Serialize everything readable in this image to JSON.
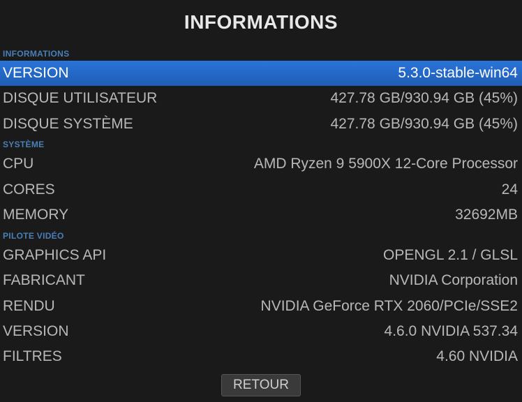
{
  "title": "INFORMATIONS",
  "sections": {
    "informations": {
      "header": "INFORMATIONS",
      "rows": [
        {
          "label": "VERSION",
          "value": "5.3.0-stable-win64",
          "selected": true
        },
        {
          "label": "DISQUE UTILISATEUR",
          "value": "427.78 GB/930.94 GB (45%)"
        },
        {
          "label": "DISQUE SYSTÈME",
          "value": "427.78 GB/930.94 GB (45%)"
        }
      ]
    },
    "systeme": {
      "header": "SYSTÈME",
      "rows": [
        {
          "label": "CPU",
          "value": "AMD Ryzen 9 5900X 12-Core Processor"
        },
        {
          "label": "CORES",
          "value": "24"
        },
        {
          "label": "MEMORY",
          "value": "32692MB"
        }
      ]
    },
    "pilote_video": {
      "header": "PILOTE VIDÉO",
      "rows": [
        {
          "label": "GRAPHICS API",
          "value": "OPENGL 2.1 / GLSL"
        },
        {
          "label": "FABRICANT",
          "value": "NVIDIA Corporation"
        },
        {
          "label": "RENDU",
          "value": "NVIDIA GeForce RTX 2060/PCIe/SSE2"
        },
        {
          "label": "VERSION",
          "value": "4.6.0 NVIDIA 537.34"
        },
        {
          "label": "FILTRES",
          "value": "4.60 NVIDIA"
        }
      ]
    }
  },
  "footer": {
    "back_label": "RETOUR"
  }
}
